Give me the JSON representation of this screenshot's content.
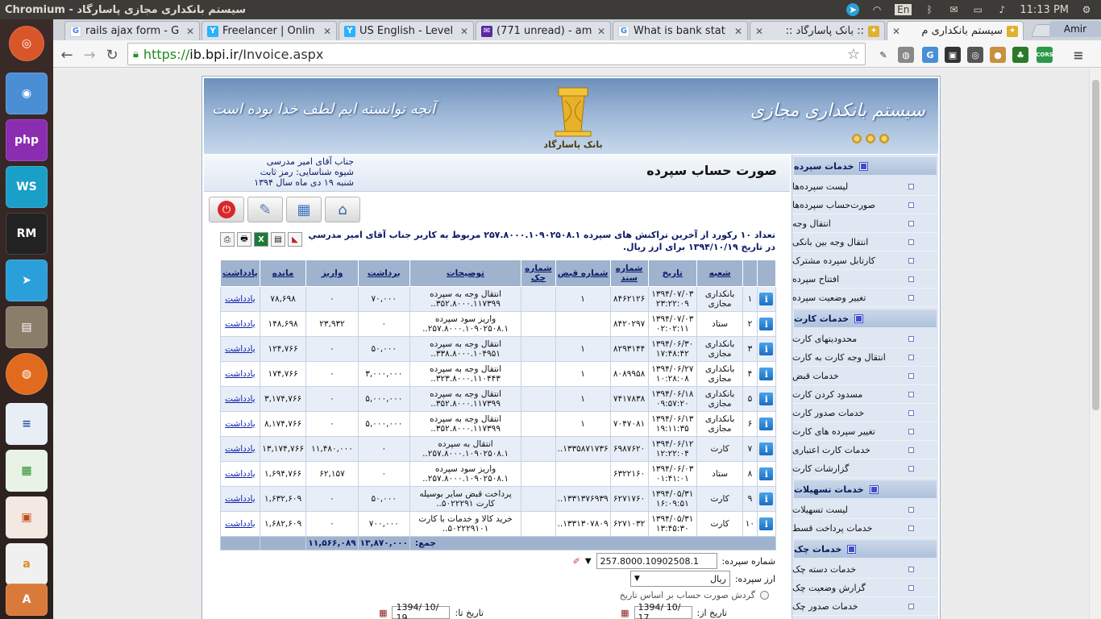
{
  "os": {
    "app_title": "Chromium - سیستم بانکداری مجازی پاسارگاد",
    "keyboard": "En",
    "clock": "11:13 PM"
  },
  "tabs": [
    {
      "label": "rails ajax form - G",
      "icon": "google-icon"
    },
    {
      "label": "Freelancer | Onlin",
      "icon": "freelancer-icon"
    },
    {
      "label": "US English - Level",
      "icon": "freelancer-icon"
    },
    {
      "label": "(771 unread) - am",
      "icon": "yahoo-mail-icon"
    },
    {
      "label": "What is bank stat",
      "icon": "google-icon"
    },
    {
      "label": ":: بانک پاسارگاد ::",
      "icon": "pasargad-icon"
    },
    {
      "label": "سیستم بانکداری م",
      "icon": "pasargad-icon"
    }
  ],
  "profile_name": "Amir",
  "address": {
    "https": "https://",
    "host": "ib.bpi.ir",
    "path": "/Invoice.aspx"
  },
  "banner": {
    "bank_title": "سیستم بانکداری مجازی",
    "motto": "آنچه توانسته ایم لطف خدا بوده است",
    "logo_text": "بانک پاسارگاد"
  },
  "page_title": "صورت حساب سپرده",
  "user": {
    "name": "جناب آقای امیر مدرسی",
    "auth": "شیوه شناسایی: رمز ثابت",
    "date": "شنبه ۱۹ دی ماه سال ۱۳۹۴"
  },
  "summary": "تعداد ۱۰ رکورد از آخرین تراکنش های سپرده ۲۵۷.۸۰۰۰.۱۰۹۰۲۵۰۸.۱ مربوط به کاربر جناب آقای امیر مدرسي در تاریخ ۱۳۹۴/۱۰/۱۹ برای ارز ریال.",
  "sidebar": [
    {
      "title": "خدمات سپرده",
      "items": [
        "لیست سپرده‌ها",
        "صورت‌حساب سپرده‌ها",
        "انتقال وجه",
        "انتقال وجه بین بانکی",
        "کارتابل سپرده مشترک",
        "افتتاح سپرده",
        "تغییر وضعیت سپرده"
      ]
    },
    {
      "title": "خدمات کارت",
      "items": [
        "محدودیتهای کارت",
        "انتقال وجه کارت به کارت",
        "خدمات قبض",
        "مسدود کردن کارت",
        "خدمات صدور کارت",
        "تغییر سپرده های کارت",
        "خدمات کارت اعتباری",
        "گزارشات کارت"
      ]
    },
    {
      "title": "خدمات تسهیلات",
      "items": [
        "لیست تسهیلات",
        "خدمات پرداخت قسط"
      ]
    },
    {
      "title": "خدمات چک",
      "items": [
        "خدمات دسته چک",
        "گزارش وضعیت چک",
        "خدمات صدور چک"
      ]
    }
  ],
  "table": {
    "headers": [
      "شعبه",
      "تاریخ",
      "شماره سند",
      "شماره قبض",
      "شماره چک",
      "توضیحات",
      "برداشت",
      "واریز",
      "مانده",
      "یادداشت"
    ],
    "rows": [
      {
        "n": "۱",
        "branch": "بانکداری مجازی",
        "date": "۱۳۹۴/۰۷/۰۳ ۲۳:۲۲:۰۹",
        "doc": "۸۴۶۲۱۲۶",
        "bill": "۱",
        "cheque": "",
        "desc": "انتقال وجه به سپرده ۳۵۲.۸۰۰۰.۱۱۷۳۹۹..",
        "withdraw": "۷۰,۰۰۰",
        "deposit": "۰",
        "balance": "۷۸,۶۹۸",
        "note": "یادداشت"
      },
      {
        "n": "۲",
        "branch": "ستاد",
        "date": "۱۳۹۴/۰۷/۰۳ ۰۲:۰۲:۱۱",
        "doc": "۸۴۲۰۲۹۷",
        "bill": "",
        "cheque": "",
        "desc": "واریز سود سپرده ۲۵۷.۸۰۰۰.۱۰۹۰۲۵۰۸.۱..",
        "withdraw": "۰",
        "deposit": "۲۳,۹۳۲",
        "balance": "۱۴۸,۶۹۸",
        "note": "یادداشت"
      },
      {
        "n": "۳",
        "branch": "بانکداری مجازی",
        "date": "۱۳۹۴/۰۶/۳۰ ۱۷:۴۸:۴۲",
        "doc": "۸۲۹۳۱۴۴",
        "bill": "۱",
        "cheque": "",
        "desc": "انتقال وجه به سپرده ۳۳۸.۸۰۰۰.۱۰۴۹۵۱..",
        "withdraw": "۵۰,۰۰۰",
        "deposit": "۰",
        "balance": "۱۲۴,۷۶۶",
        "note": "یادداشت"
      },
      {
        "n": "۴",
        "branch": "بانکداری مجازی",
        "date": "۱۳۹۴/۰۶/۲۷ ۱۰:۲۸:۰۸",
        "doc": "۸۰۸۹۹۵۸",
        "bill": "۱",
        "cheque": "",
        "desc": "انتقال وجه به سپرده ۳۲۳.۸۰۰۰.۱۱۰۴۴۳..",
        "withdraw": "۳,۰۰۰,۰۰۰",
        "deposit": "۰",
        "balance": "۱۷۴,۷۶۶",
        "note": "یادداشت"
      },
      {
        "n": "۵",
        "branch": "بانکداری مجازی",
        "date": "۱۳۹۴/۰۶/۱۸ ۰۹:۵۷:۲۰",
        "doc": "۷۴۱۷۸۳۸",
        "bill": "۱",
        "cheque": "",
        "desc": "انتقال وجه به سپرده ۳۵۲.۸۰۰۰.۱۱۷۳۹۹..",
        "withdraw": "۵,۰۰۰,۰۰۰",
        "deposit": "۰",
        "balance": "۳,۱۷۴,۷۶۶",
        "note": "یادداشت"
      },
      {
        "n": "۶",
        "branch": "بانکداری مجازی",
        "date": "۱۳۹۴/۰۶/۱۳ ۱۹:۱۱:۳۵",
        "doc": "۷۰۴۷۰۸۱",
        "bill": "۱",
        "cheque": "",
        "desc": "انتقال وجه به سپرده ۳۵۲.۸۰۰۰.۱۱۷۳۹۹..",
        "withdraw": "۵,۰۰۰,۰۰۰",
        "deposit": "۰",
        "balance": "۸,۱۷۴,۷۶۶",
        "note": "یادداشت"
      },
      {
        "n": "۷",
        "branch": "کارت",
        "date": "۱۳۹۴/۰۶/۱۲ ۱۲:۲۲:۰۴",
        "doc": "۶۹۸۷۶۲۰",
        "bill": "۱۳۳۵۸۷۱۷۳۶..",
        "cheque": "",
        "desc": "انتقال به سپرده ۲۵۷.۸۰۰۰.۱۰۹۰۲۵۰۸.۱..",
        "withdraw": "۰",
        "deposit": "۱۱,۴۸۰,۰۰۰",
        "balance": "۱۳,۱۷۴,۷۶۶",
        "note": "یادداشت"
      },
      {
        "n": "۸",
        "branch": "ستاد",
        "date": "۱۳۹۴/۰۶/۰۳ ۰۱:۴۱:۰۱",
        "doc": "۶۳۲۲۱۶۰",
        "bill": "",
        "cheque": "",
        "desc": "واریز سود سپرده ۲۵۷.۸۰۰۰.۱۰۹۰۲۵۰۸.۱..",
        "withdraw": "۰",
        "deposit": "۶۲,۱۵۷",
        "balance": "۱,۶۹۴,۷۶۶",
        "note": "یادداشت"
      },
      {
        "n": "۹",
        "branch": "کارت",
        "date": "۱۳۹۴/۰۵/۳۱ ۱۶:۰۹:۵۱",
        "doc": "۶۲۷۱۷۶۰",
        "bill": "۱۳۳۱۳۷۶۹۳۹..",
        "cheque": "",
        "desc": "پرداخت قبض سایر بوسیله کارت ۵۰۲۲۲۹۱..",
        "withdraw": "۵۰,۰۰۰",
        "deposit": "۰",
        "balance": "۱,۶۳۲,۶۰۹",
        "note": "یادداشت"
      },
      {
        "n": "۱۰",
        "branch": "کارت",
        "date": "۱۳۹۴/۰۵/۳۱ ۱۳:۴۵:۳۰",
        "doc": "۶۲۷۱۰۳۲",
        "bill": "۱۳۳۱۳۰۷۸۰۹..",
        "cheque": "",
        "desc": "خرید کالا و خدمات با کارت ۵۰۲۲۲۹۱۰۱..",
        "withdraw": "۷۰۰,۰۰۰",
        "deposit": "۰",
        "balance": "۱,۶۸۲,۶۰۹",
        "note": "یادداشت"
      }
    ],
    "total_label": "جمع:",
    "total_withdraw": "۱۳,۸۷۰,۰۰۰",
    "total_deposit": "۱۱,۵۶۶,۰۸۹"
  },
  "form": {
    "account_label": "شماره سپرده:",
    "account_value": "257.8000.10902508.1",
    "currency_label": "ارز سپرده:",
    "currency_value": "ریال",
    "radio_label": "گردش صورت حساب بر اساس تاریخ",
    "from_label": "تاریخ از:",
    "from_value": "1394/ 10/ 17",
    "to_label": "تاریخ تا:",
    "to_value": "1394/ 10/ 19"
  }
}
